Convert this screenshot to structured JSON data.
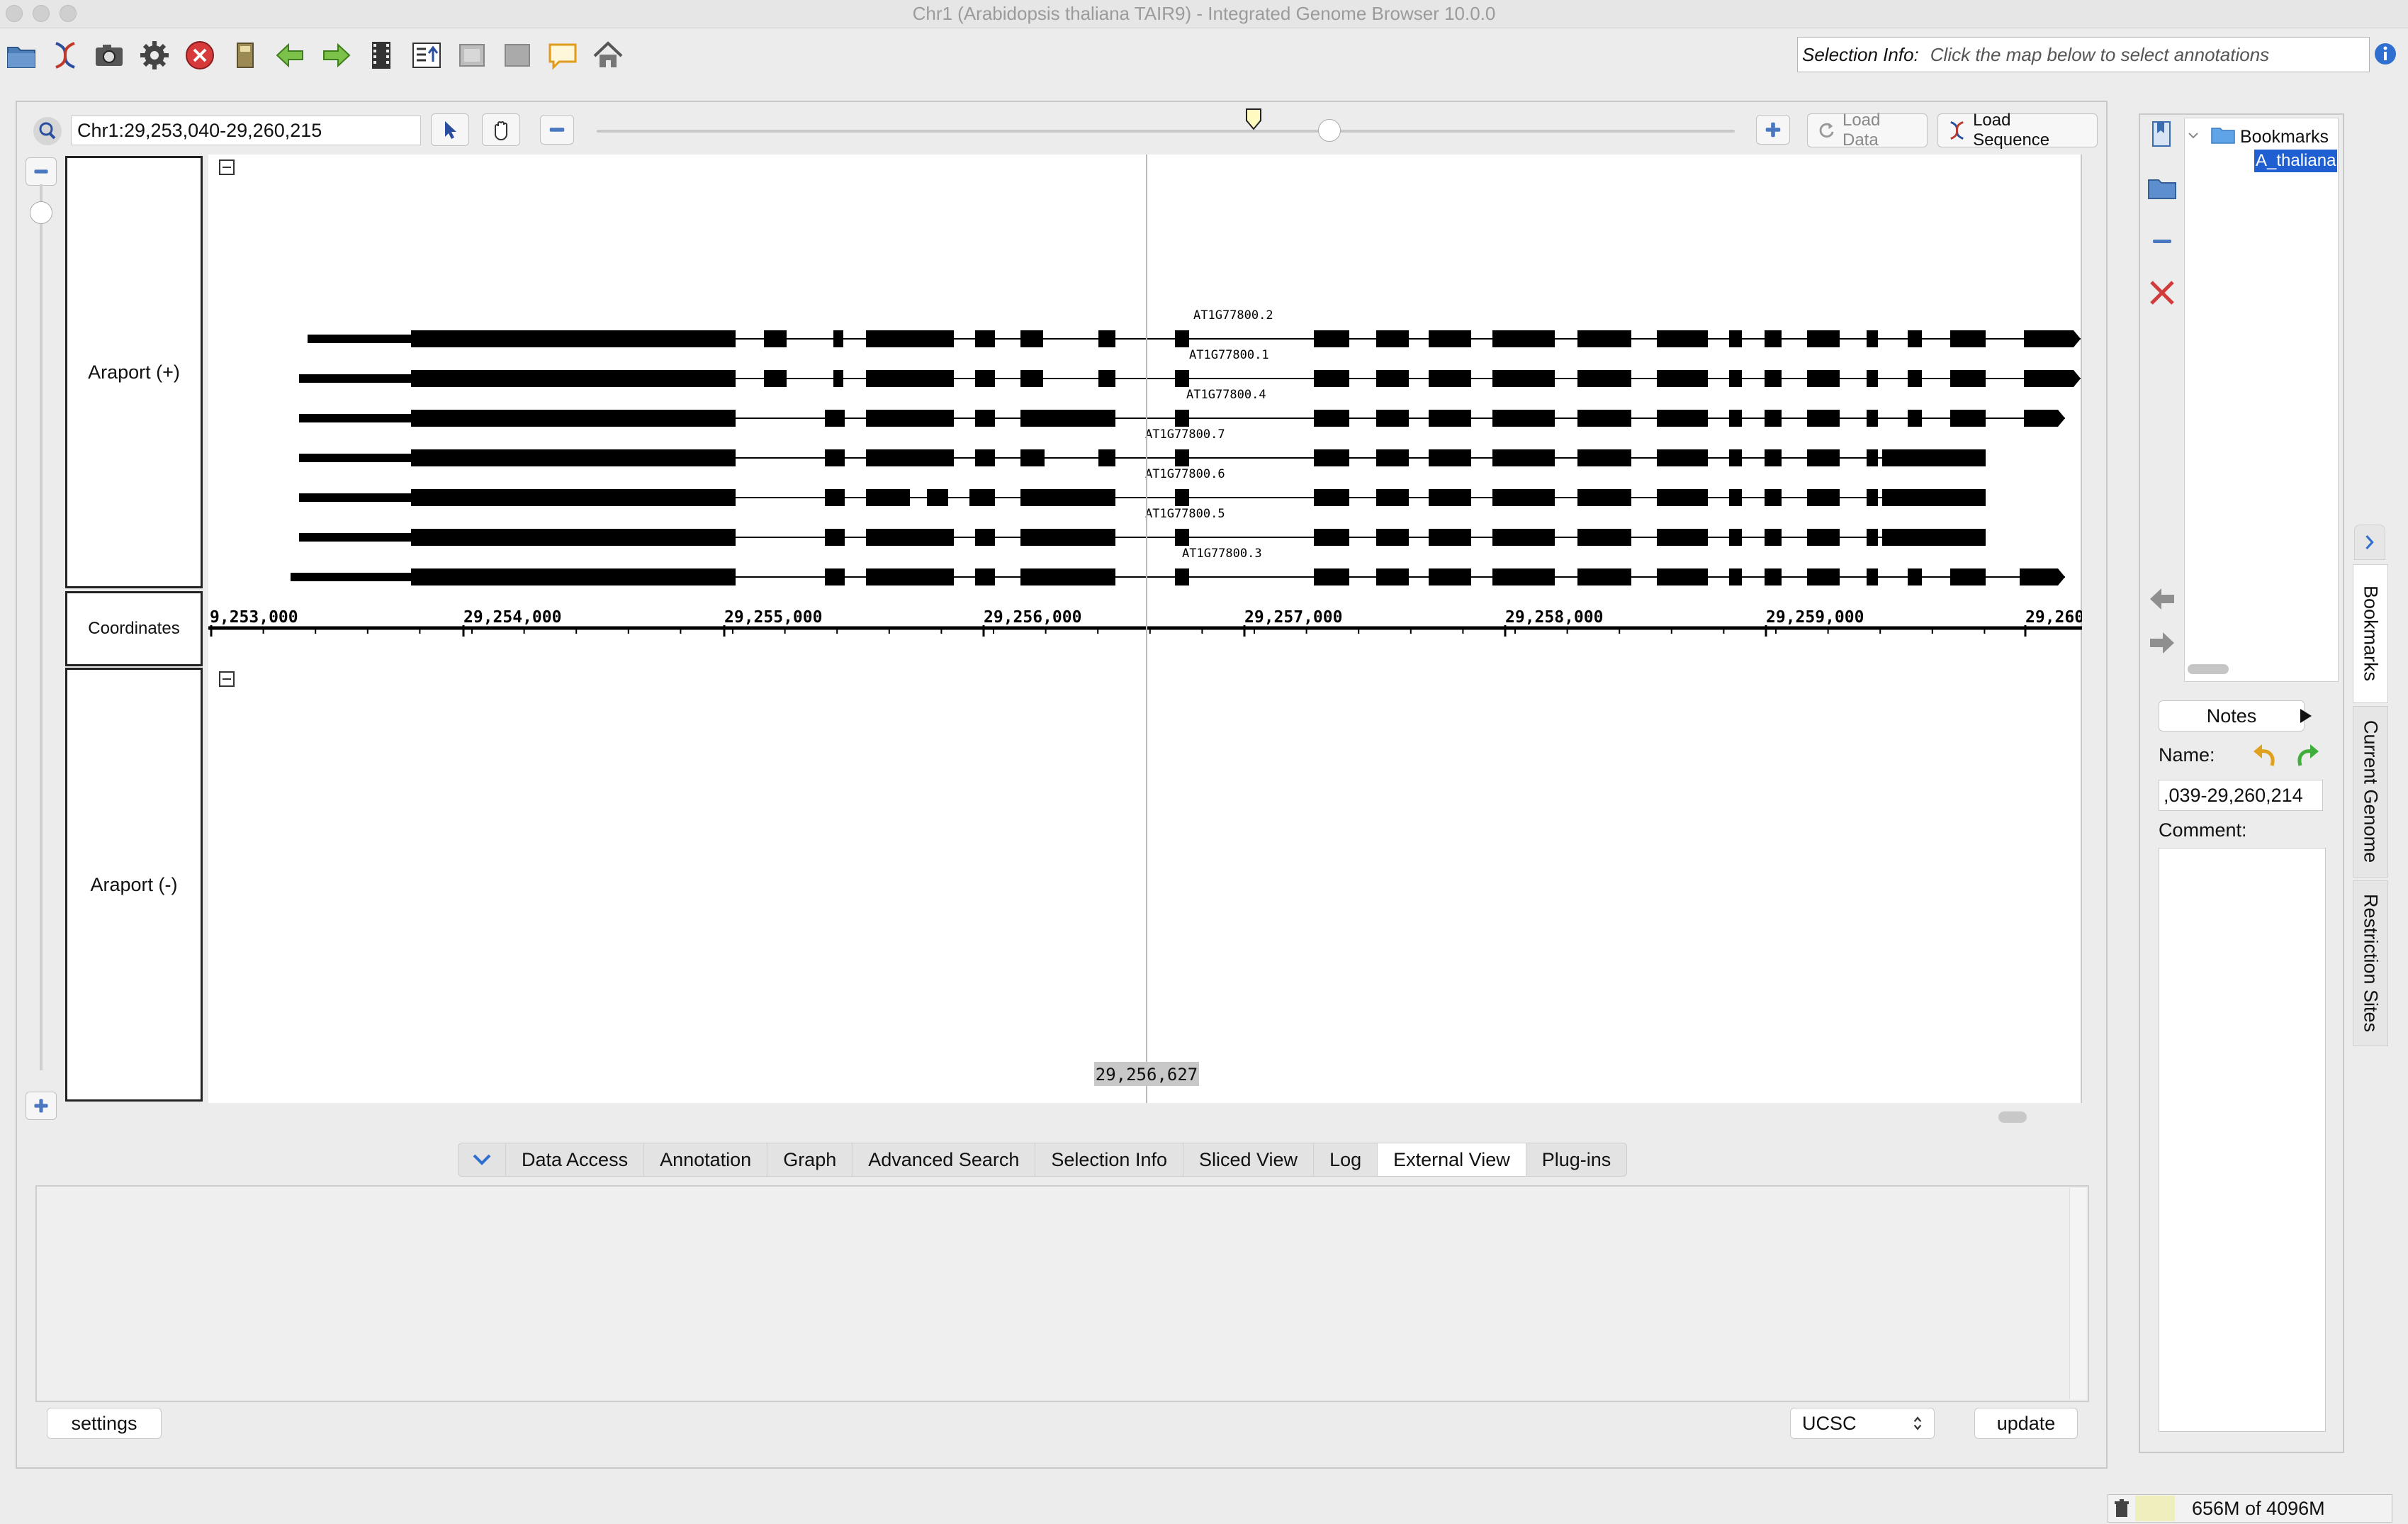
{
  "window": {
    "title": "Chr1  (Arabidopsis thaliana TAIR9) - Integrated Genome Browser 10.0.0"
  },
  "selection_info": {
    "label": "Selection Info:",
    "hint": "Click the map below to select annotations"
  },
  "location": {
    "value": "Chr1:29,253,040-29,260,215"
  },
  "zoom": {
    "level": 0.55
  },
  "buttons": {
    "load_data": "Load Data",
    "load_sequence": "Load Sequence",
    "settings": "settings",
    "update": "update"
  },
  "tracks": {
    "plus_label": "Araport (+)",
    "coordinates_label": "Coordinates",
    "minus_label": "Araport (-)"
  },
  "coordinates": {
    "ticks": [
      "9,253,000",
      "29,254,000",
      "29,255,000",
      "29,256,000",
      "29,257,000",
      "29,258,000",
      "29,259,000",
      "29,260"
    ],
    "cursor_readout": "29,256,627"
  },
  "transcripts": [
    {
      "name": "AT1G77800.2"
    },
    {
      "name": "AT1G77800.1"
    },
    {
      "name": "AT1G77800.4"
    },
    {
      "name": "AT1G77800.7"
    },
    {
      "name": "AT1G77800.6"
    },
    {
      "name": "AT1G77800.5"
    },
    {
      "name": "AT1G77800.3"
    }
  ],
  "tabs": [
    "Data Access",
    "Annotation",
    "Graph",
    "Advanced Search",
    "Selection Info",
    "Sliced View",
    "Log",
    "External View",
    "Plug-ins"
  ],
  "active_tab": "External View",
  "external_view": {
    "source": "UCSC"
  },
  "bookmarks": {
    "root": "Bookmarks",
    "item": "A_thaliana"
  },
  "notes": {
    "button": "Notes",
    "name_label": "Name:",
    "name_value": ",039-29,260,214",
    "comment_label": "Comment:"
  },
  "side_tabs": [
    "Bookmarks",
    "Current Genome",
    "Restriction Sites"
  ],
  "memory": {
    "text": "656M of 4096M"
  }
}
